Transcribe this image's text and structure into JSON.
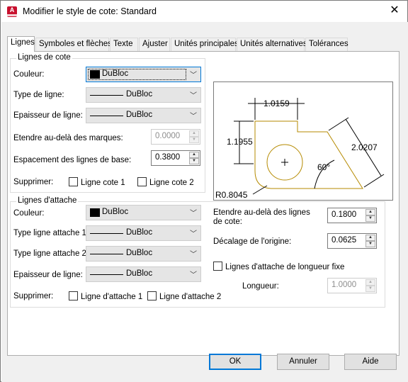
{
  "window": {
    "title": "Modifier le style de cote: Standard",
    "close_glyph": "✕",
    "app_icon_letter": "A"
  },
  "tabs": [
    "Lignes",
    "Symboles et flèches",
    "Texte",
    "Ajuster",
    "Unités principales",
    "Unités alternatives",
    "Tolérances"
  ],
  "dim_lines": {
    "group_label": "Lignes de cote",
    "color_label": "Couleur:",
    "color_value": "DuBloc",
    "linetype_label": "Type de ligne:",
    "linetype_value": "DuBloc",
    "lineweight_label": "Epaisseur de ligne:",
    "lineweight_value": "DuBloc",
    "extend_label": "Etendre au-delà des marques:",
    "extend_value": "0.0000",
    "baseline_label": "Espacement des lignes de base:",
    "baseline_value": "0.3800",
    "suppress_label": "Supprimer:",
    "suppress_1": "Ligne cote 1",
    "suppress_2": "Ligne cote 2"
  },
  "ext_lines": {
    "group_label": "Lignes d'attache",
    "color_label": "Couleur:",
    "color_value": "DuBloc",
    "linetype1_label": "Type ligne attache 1:",
    "linetype1_value": "DuBloc",
    "linetype2_label": "Type ligne attache 2:",
    "linetype2_value": "DuBloc",
    "lineweight_label": "Epaisseur de ligne:",
    "lineweight_value": "DuBloc",
    "suppress_label": "Supprimer:",
    "suppress_1": "Ligne d'attache 1",
    "suppress_2": "Ligne d'attache 2",
    "extend_label": "Etendre au-delà des lignes de cote:",
    "extend_value": "0.1800",
    "offset_label": "Décalage de l'origine:",
    "offset_value": "0.0625",
    "fixed_label": "Lignes d'attache de longueur fixe",
    "length_label": "Longueur:",
    "length_value": "1.0000"
  },
  "preview": {
    "dim_top": "1.0159",
    "dim_left": "1.1955",
    "dim_right": "2.0207",
    "angle": "60°",
    "radius": "R0.8045"
  },
  "buttons": {
    "ok": "OK",
    "cancel": "Annuler",
    "help": "Aide"
  },
  "colors": {
    "accent": "#0078d7",
    "geometry": "#b58a00",
    "close_red": "#c8102e"
  }
}
